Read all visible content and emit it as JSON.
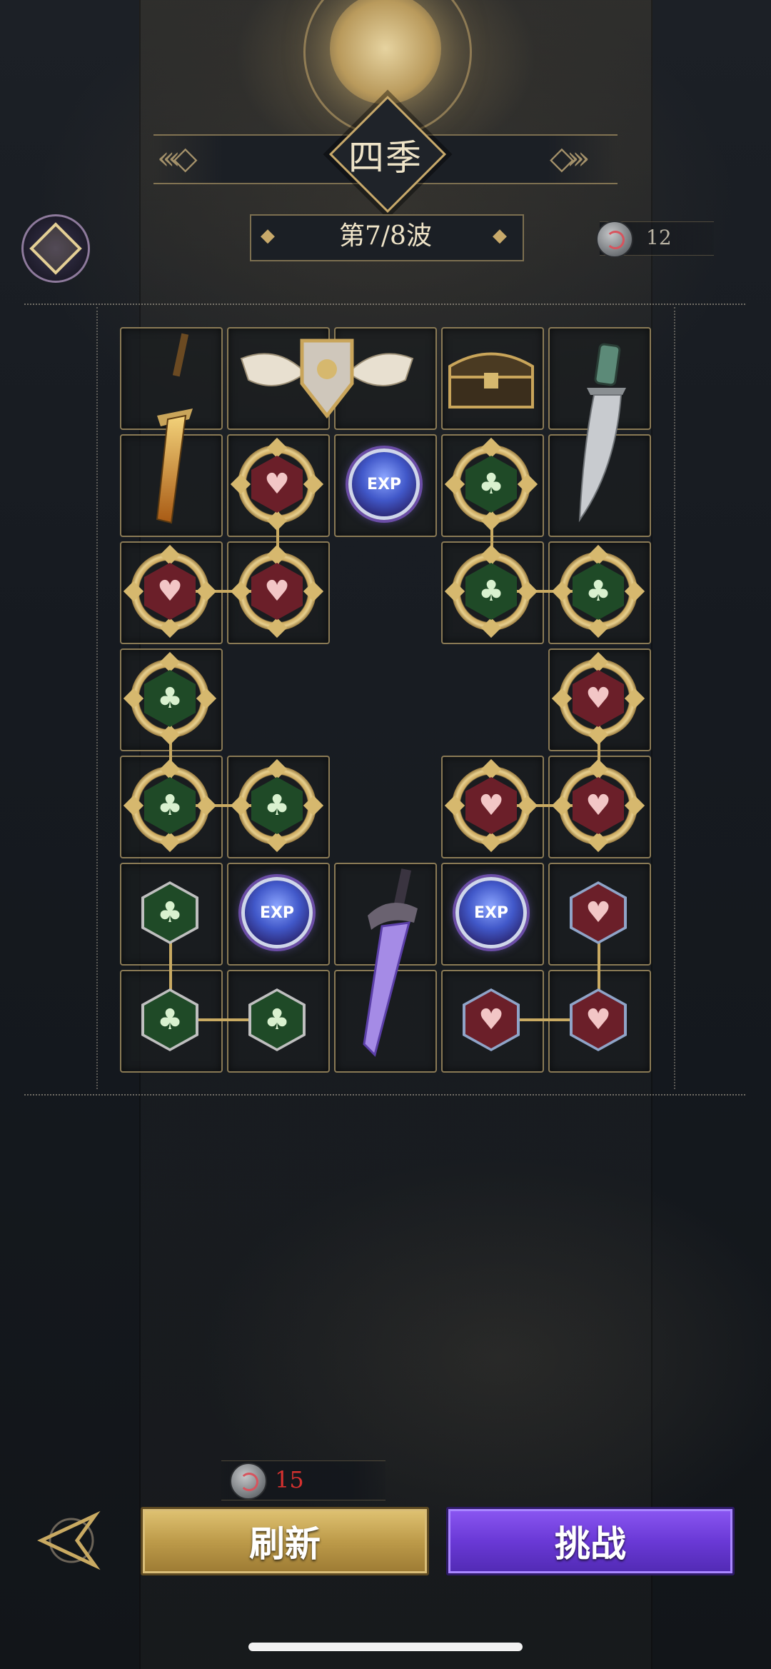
{
  "header": {
    "title": "四季",
    "wave_label": "第7/8波",
    "currency_count": "12"
  },
  "board": {
    "rows": [
      [
        "golden-dagger",
        "winged-shield",
        "treasure-chest",
        "jade-knife"
      ],
      [
        "golden-dagger",
        "heart-node",
        "exp-node",
        "club-node",
        "jade-knife"
      ],
      [
        "heart-node",
        "heart-node",
        "empty",
        "club-node",
        "club-node"
      ],
      [
        "club-node",
        "empty",
        "empty",
        "empty",
        "heart-node"
      ],
      [
        "club-node",
        "club-node",
        "empty",
        "heart-node",
        "heart-node"
      ],
      [
        "club-node-small",
        "exp-node",
        "violet-sword",
        "exp-node",
        "heart-node-small"
      ],
      [
        "club-node-small",
        "club-node-small",
        "violet-sword",
        "heart-node-small",
        "heart-node-small"
      ]
    ],
    "exp_label": "EXP"
  },
  "footer": {
    "refresh_cost": "15",
    "refresh_label": "刷新",
    "challenge_label": "挑战"
  },
  "colors": {
    "gold": "#c9aa62",
    "heart": "#6b1f29",
    "club": "#1f4a27",
    "challenge": "#6a39d6",
    "cost_red": "#d6312f"
  }
}
